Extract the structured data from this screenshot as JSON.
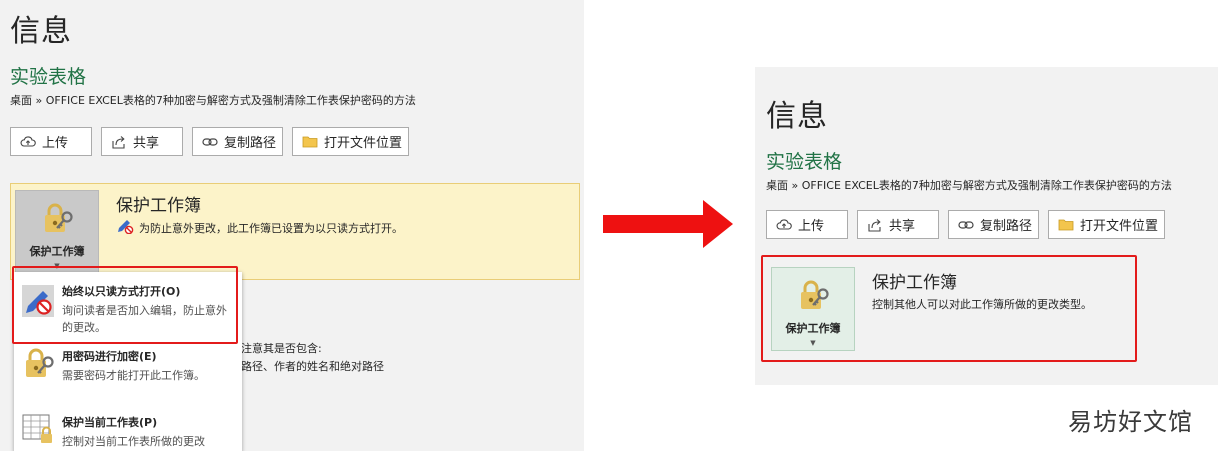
{
  "colors": {
    "accent": "#217346",
    "highlight": "#fcf3c9",
    "red": "#e31b1b"
  },
  "left_panel": {
    "title": "信息",
    "doc_name": "实验表格",
    "path": "桌面 » OFFICE EXCEL表格的7种加密与解密方式及强制清除工作表保护密码的方法",
    "buttons": {
      "upload": "上传",
      "share": "共享",
      "copy_path": "复制路径",
      "open_location": "打开文件位置"
    },
    "protect": {
      "tile_label": "保护工作簿",
      "heading": "保护工作簿",
      "desc": "为防止意外更改，此工作簿已设置为以只读方式打开。"
    },
    "menu": [
      {
        "title": "始终以只读方式打开(O)",
        "desc": "询问读者是否加入编辑，防止意外的更改。",
        "icon": "pencil-no-icon"
      },
      {
        "title": "用密码进行加密(E)",
        "desc": "需要密码才能打开此工作簿。",
        "icon": "lock-key-icon"
      },
      {
        "title": "保护当前工作表(P)",
        "desc": "控制对当前工作表所做的更改",
        "icon": "sheet-lock-icon"
      }
    ],
    "behind_text": {
      "line1": "注意其是否包含:",
      "line2": "路径、作者的姓名和绝对路径"
    }
  },
  "right_panel": {
    "title": "信息",
    "doc_name": "实验表格",
    "path": "桌面 » OFFICE EXCEL表格的7种加密与解密方式及强制清除工作表保护密码的方法",
    "buttons": {
      "upload": "上传",
      "share": "共享",
      "copy_path": "复制路径",
      "open_location": "打开文件位置"
    },
    "protect": {
      "tile_label": "保护工作簿",
      "heading": "保护工作簿",
      "desc": "控制其他人可以对此工作簿所做的更改类型。"
    }
  },
  "watermark": "易坊好文馆"
}
